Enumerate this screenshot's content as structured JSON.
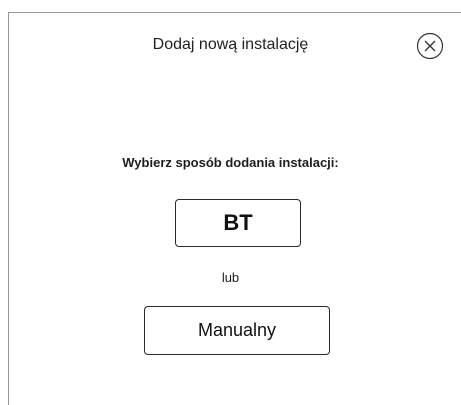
{
  "dialog": {
    "title": "Dodaj nową instalację",
    "close_icon": "close-circle-icon"
  },
  "main": {
    "prompt": "Wybierz sposób dodania instalacji:",
    "bt_label": "BT",
    "or_label": "lub",
    "manual_label": "Manualny"
  }
}
